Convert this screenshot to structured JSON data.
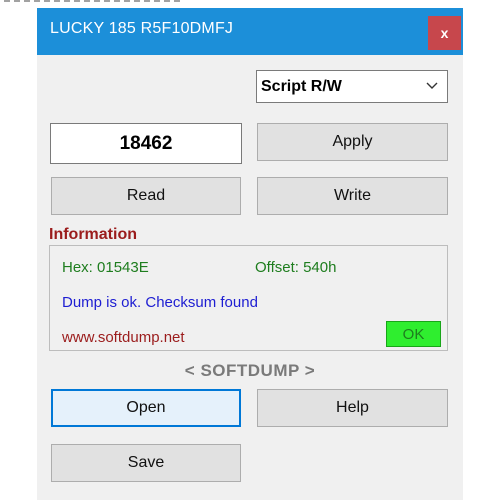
{
  "window": {
    "title": "LUCKY 185 R5F10DMFJ",
    "close_label": "x"
  },
  "controls": {
    "script_select": {
      "value": "Script R/W",
      "icon": "chevron-down-icon"
    },
    "number_value": "18462",
    "apply_label": "Apply",
    "read_label": "Read",
    "write_label": "Write"
  },
  "information": {
    "label": "Information",
    "hex": "Hex: 01543E",
    "offset": "Offset: 540h",
    "dump_status": "Dump is ok. Checksum found",
    "website": "www.softdump.net",
    "ok_badge": "OK"
  },
  "branding": {
    "logo_text": "< SOFTDUMP >"
  },
  "actions": {
    "open_label": "Open",
    "help_label": "Help",
    "save_label": "Save"
  },
  "colors": {
    "titlebar": "#1c8fd9",
    "close_button": "#c7474c",
    "info_label": "#9b1c1c",
    "hex_offset_text": "#1e7d1e",
    "dump_text": "#1e1ed2",
    "ok_badge": "#2fee2f",
    "focus_border": "#0078d7"
  }
}
